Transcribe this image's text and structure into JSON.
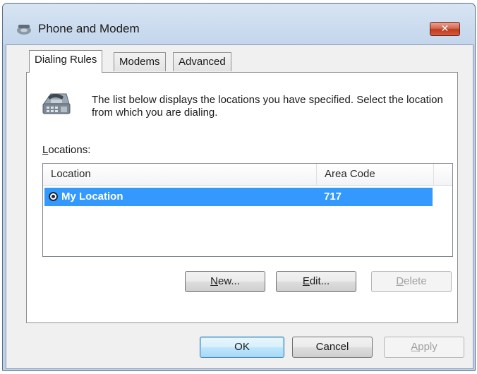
{
  "window": {
    "title": "Phone and Modem",
    "close_label": "✕"
  },
  "tabs": [
    {
      "label": "Dialing Rules",
      "active": true
    },
    {
      "label": "Modems",
      "active": false
    },
    {
      "label": "Advanced",
      "active": false
    }
  ],
  "dialing_rules": {
    "intro": "The list below displays the locations you have specified. Select the location from which you are dialing.",
    "locations_label_mnemonic": "L",
    "locations_label_rest": "ocations:",
    "columns": [
      "Location",
      "Area Code"
    ],
    "rows": [
      {
        "location": "My Location",
        "area_code": "717",
        "selected": true
      }
    ],
    "buttons": {
      "new": {
        "mnemonic": "N",
        "rest": "ew..."
      },
      "edit": {
        "mnemonic": "E",
        "rest": "dit..."
      },
      "delete": {
        "mnemonic": "D",
        "rest": "elete",
        "disabled": true
      }
    }
  },
  "footer": {
    "ok": "OK",
    "cancel": "Cancel",
    "apply": {
      "mnemonic": "A",
      "rest": "pply",
      "disabled": true
    }
  },
  "colors": {
    "selection": "#3399ff",
    "close_button": "#c03b22",
    "title_bar": "#c4d6ec"
  },
  "icons": {
    "title": "phone-modem-icon",
    "panel": "telephone-icon",
    "row": "selected-location-radio-icon"
  }
}
